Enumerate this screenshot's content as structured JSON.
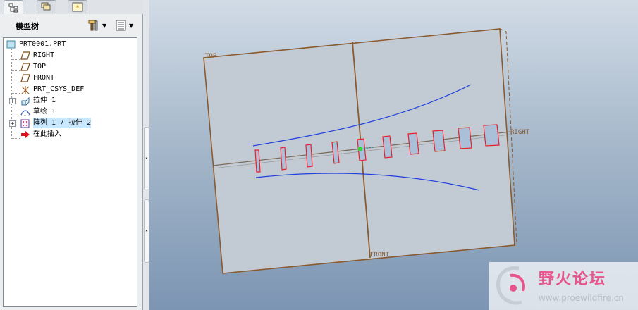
{
  "panel": {
    "title": "模型树",
    "tabs": [
      {
        "name": "model-tree-tab",
        "icon": "model-tree-icon"
      },
      {
        "name": "layers-tab",
        "icon": "layers-icon"
      },
      {
        "name": "favorites-tab",
        "icon": "favorites-icon"
      }
    ]
  },
  "tree": {
    "items": [
      {
        "label": "PRT0001.PRT",
        "icon": "part-icon"
      },
      {
        "label": "RIGHT",
        "icon": "datum-plane-icon"
      },
      {
        "label": "TOP",
        "icon": "datum-plane-icon"
      },
      {
        "label": "FRONT",
        "icon": "datum-plane-icon"
      },
      {
        "label": "PRT_CSYS_DEF",
        "icon": "csys-icon"
      },
      {
        "label": "拉伸 1",
        "icon": "extrude-icon"
      },
      {
        "label": "草绘 1",
        "icon": "sketch-icon"
      },
      {
        "label": "阵列 1 / 拉伸 2",
        "icon": "pattern-icon"
      },
      {
        "label": "在此插入",
        "icon": "insert-here-arrow-icon"
      }
    ]
  },
  "viewport": {
    "datum_labels": {
      "top": "TOP",
      "right": "RIGHT",
      "front": "FRONT"
    },
    "colors": {
      "sketch_curve": "#1f3fdc",
      "pattern_member": "#e81e2c",
      "datum_edge": "#8a5a2e"
    }
  },
  "watermark": {
    "title": "野火论坛",
    "url": "www.proewildfire.cn"
  }
}
